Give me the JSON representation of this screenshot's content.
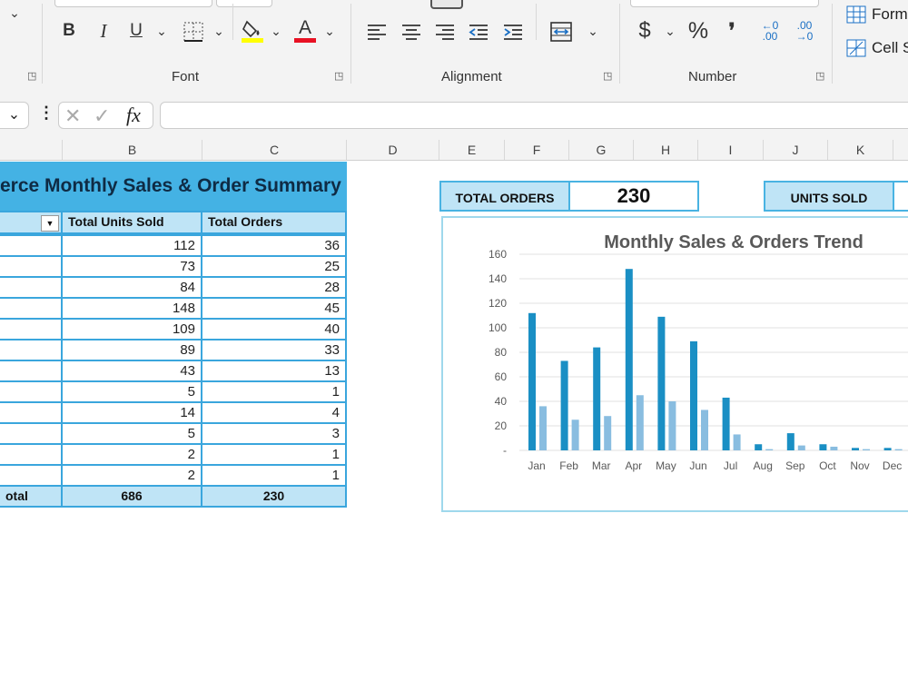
{
  "ribbon": {
    "font_group_label": "Font",
    "alignment_group_label": "Alignment",
    "number_group_label": "Number",
    "bold_label": "B",
    "italic_label": "I",
    "underline_label": "U",
    "font_color_letter": "A",
    "currency_label": "$",
    "percent_label": "%",
    "comma_label": "❜",
    "increase_decimal_label": "←0\n.00",
    "decrease_decimal_label": ".00\n→0",
    "format_table_label": "Form",
    "cell_styles_label": "Cell S",
    "highlight_color": "#ffff00",
    "font_color": "#e81123"
  },
  "formula_bar": {
    "fx_label": "fx",
    "value": ""
  },
  "columns": [
    "B",
    "C",
    "D",
    "E",
    "F",
    "G",
    "H",
    "I",
    "J",
    "K"
  ],
  "table": {
    "title": "erce Monthly Sales & Order Summary",
    "col_units": "Total Units Sold",
    "col_orders": "Total Orders",
    "rows": [
      {
        "units": "112",
        "orders": "36"
      },
      {
        "units": "73",
        "orders": "25"
      },
      {
        "units": "84",
        "orders": "28"
      },
      {
        "units": "148",
        "orders": "45"
      },
      {
        "units": "109",
        "orders": "40"
      },
      {
        "units": "89",
        "orders": "33"
      },
      {
        "units": "43",
        "orders": "13"
      },
      {
        "units": "5",
        "orders": "1"
      },
      {
        "units": "14",
        "orders": "4"
      },
      {
        "units": "5",
        "orders": "3"
      },
      {
        "units": "2",
        "orders": "1"
      },
      {
        "units": "2",
        "orders": "1"
      }
    ],
    "total_label": "otal",
    "total_units": "686",
    "total_orders": "230"
  },
  "kpi": {
    "orders_label": "TOTAL ORDERS",
    "orders_value": "230",
    "units_label": "UNITS SOLD"
  },
  "chart_data": {
    "type": "bar",
    "title": "Monthly Sales & Orders Trend",
    "categories": [
      "Jan",
      "Feb",
      "Mar",
      "Apr",
      "May",
      "Jun",
      "Jul",
      "Aug",
      "Sep",
      "Oct",
      "Nov",
      "Dec"
    ],
    "series": [
      {
        "values": [
          112,
          73,
          84,
          148,
          109,
          89,
          43,
          5,
          14,
          5,
          2,
          2
        ],
        "color": "#1a8fc4"
      },
      {
        "values": [
          36,
          25,
          28,
          45,
          40,
          33,
          13,
          1,
          4,
          3,
          1,
          1
        ],
        "color": "#89bde0"
      }
    ],
    "yticks": [
      "160",
      "140",
      "120",
      "100",
      "80",
      "60",
      "40",
      "20",
      "-"
    ],
    "ylim": [
      0,
      160
    ],
    "grid": true
  }
}
